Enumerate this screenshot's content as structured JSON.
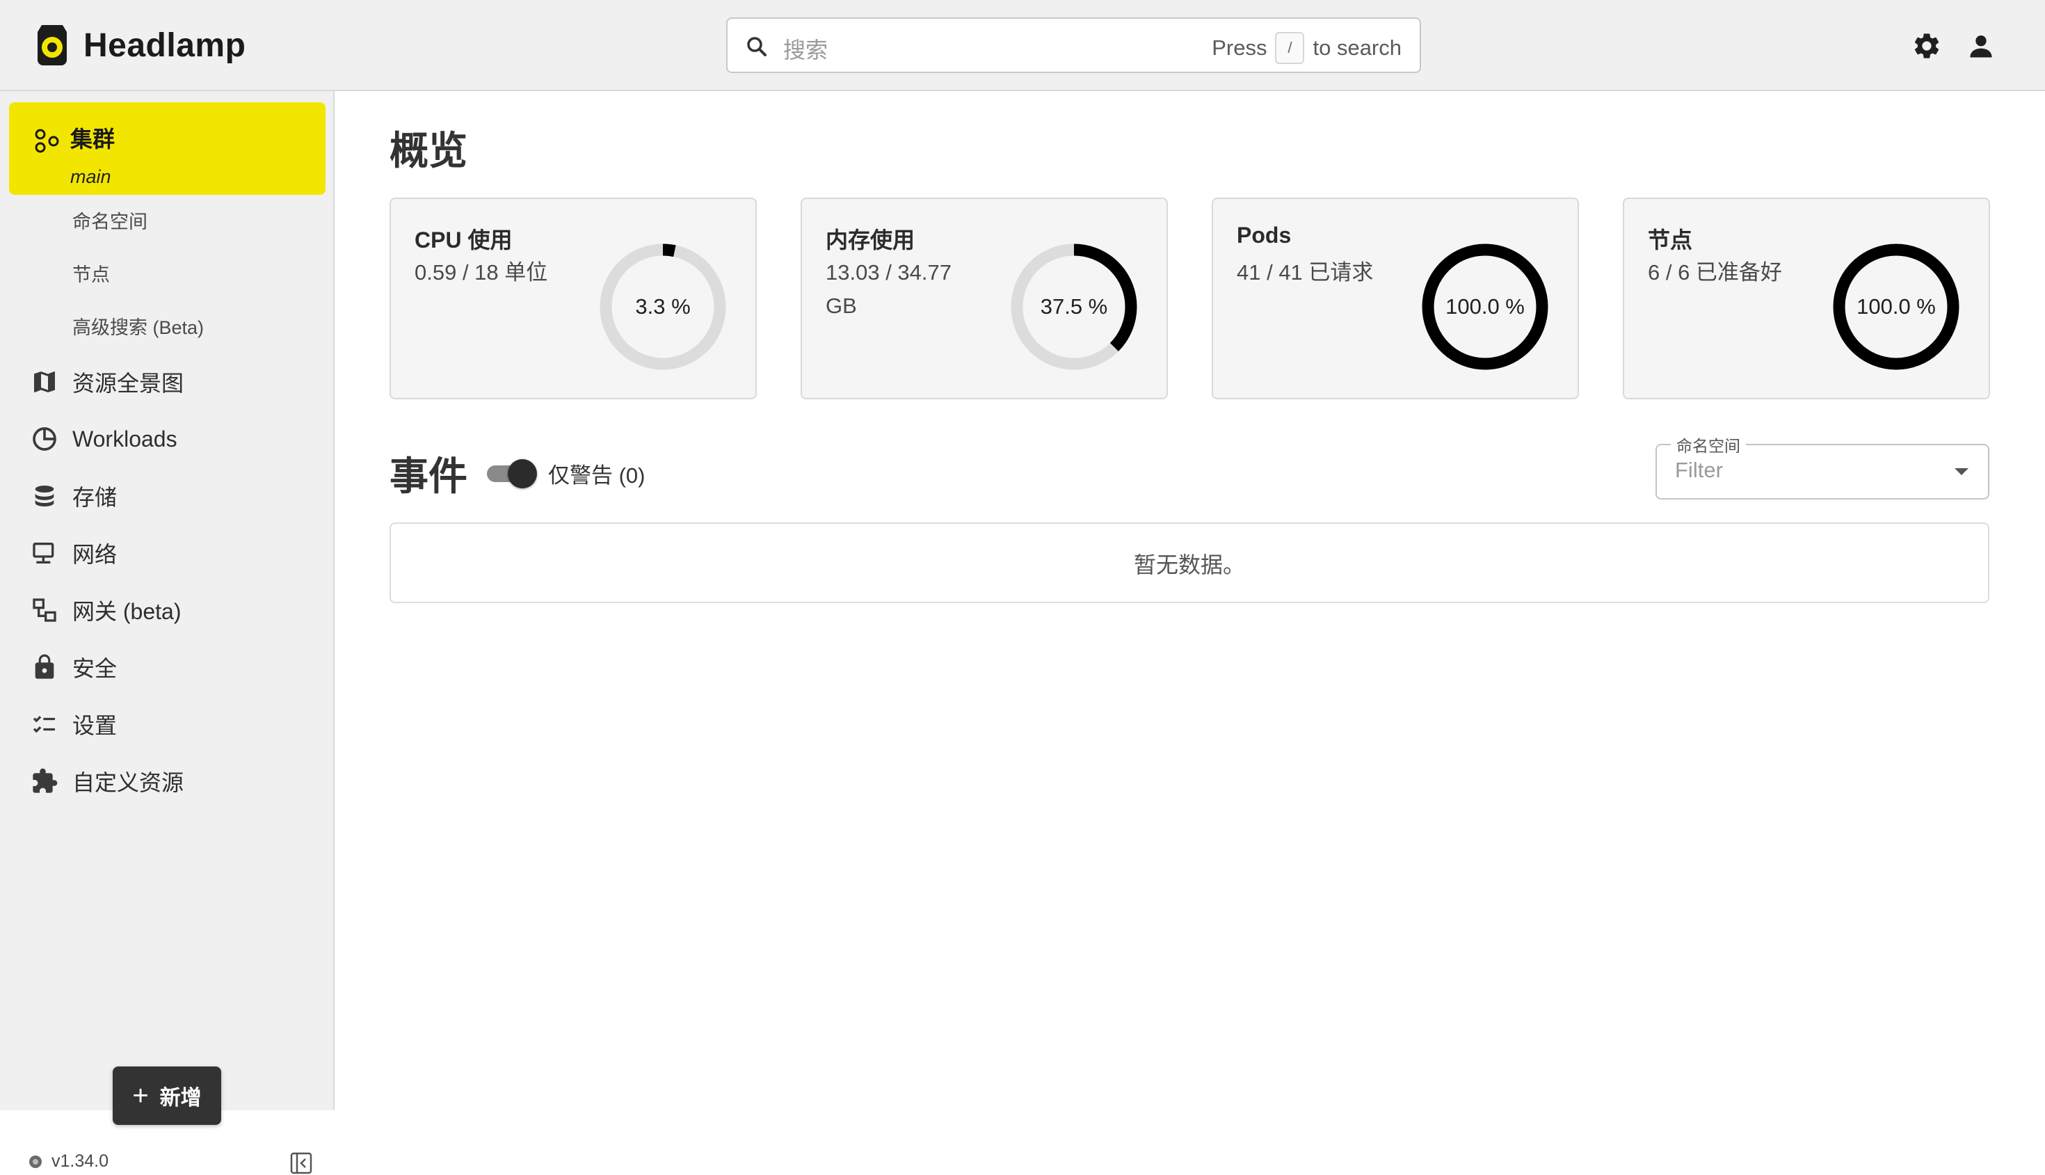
{
  "app": {
    "name": "Headlamp",
    "version": "v1.34.0",
    "brand_color": "#f2e600"
  },
  "search": {
    "placeholder": "搜索",
    "hint_prefix": "Press",
    "hint_key": "/",
    "hint_suffix": "to search"
  },
  "header": {
    "settings_icon": "gear-icon",
    "user_icon": "user-icon"
  },
  "sidebar": {
    "cluster": {
      "label": "集群",
      "sub": "main"
    },
    "cluster_subitems": [
      "命名空间",
      "节点",
      "高级搜索 (Beta)"
    ],
    "items": [
      {
        "label": "资源全景图",
        "icon": "map-icon"
      },
      {
        "label": "Workloads",
        "icon": "pie-chart-icon"
      },
      {
        "label": "存储",
        "icon": "database-icon"
      },
      {
        "label": "网络",
        "icon": "network-icon"
      },
      {
        "label": "网关 (beta)",
        "icon": "gateway-icon"
      },
      {
        "label": "安全",
        "icon": "lock-icon"
      },
      {
        "label": "设置",
        "icon": "checklist-icon"
      },
      {
        "label": "自定义资源",
        "icon": "puzzle-icon"
      }
    ],
    "new_button": "新增"
  },
  "overview": {
    "title": "概览",
    "cards": [
      {
        "title": "CPU 使用",
        "value": "0.59 / 18 单位",
        "percent_label": "3.3 %",
        "percent": 3.3
      },
      {
        "title": "内存使用",
        "value": "13.03 / 34.77 GB",
        "percent_label": "37.5 %",
        "percent": 37.5
      },
      {
        "title": "Pods",
        "value": "41 / 41 已请求",
        "percent_label": "100.0 %",
        "percent": 100.0
      },
      {
        "title": "节点",
        "value": "6 / 6 已准备好",
        "percent_label": "100.0 %",
        "percent": 100.0
      }
    ]
  },
  "events": {
    "title": "事件",
    "warnings_only_label": "仅警告 (0)",
    "warnings_only_enabled": true,
    "namespace_label": "命名空间",
    "namespace_placeholder": "Filter",
    "empty_text": "暂无数据。"
  }
}
